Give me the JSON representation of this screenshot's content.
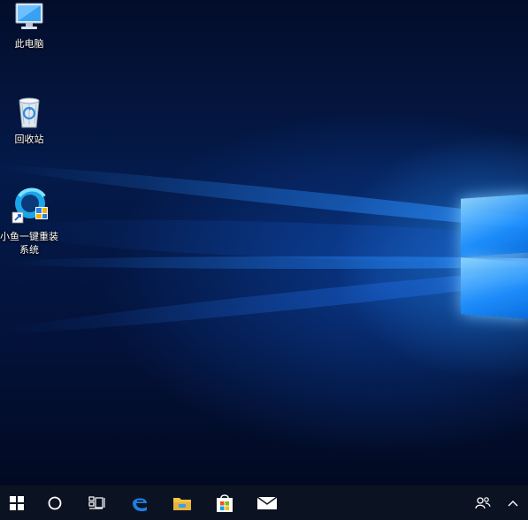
{
  "desktop": {
    "icons": [
      {
        "label": "此电脑",
        "icon": "this-pc-icon"
      },
      {
        "label": "回收站",
        "icon": "recycle-bin-icon"
      },
      {
        "label": "小鱼一键重装系统",
        "label_line1": "小鱼一键重装",
        "label_line2": "系统",
        "icon": "xiaoyu-reinstall-icon"
      }
    ]
  },
  "taskbar": {
    "items": [
      "start-icon",
      "cortana-search-icon",
      "task-view-icon",
      "edge-icon",
      "file-explorer-icon",
      "store-icon",
      "mail-icon"
    ],
    "tray": [
      "people-icon",
      "show-hidden-icons-chevron"
    ]
  },
  "colors": {
    "taskbar_bg": "#0b1222",
    "edge_blue": "#1f7ee0",
    "folder_yellow": "#f5c445"
  }
}
